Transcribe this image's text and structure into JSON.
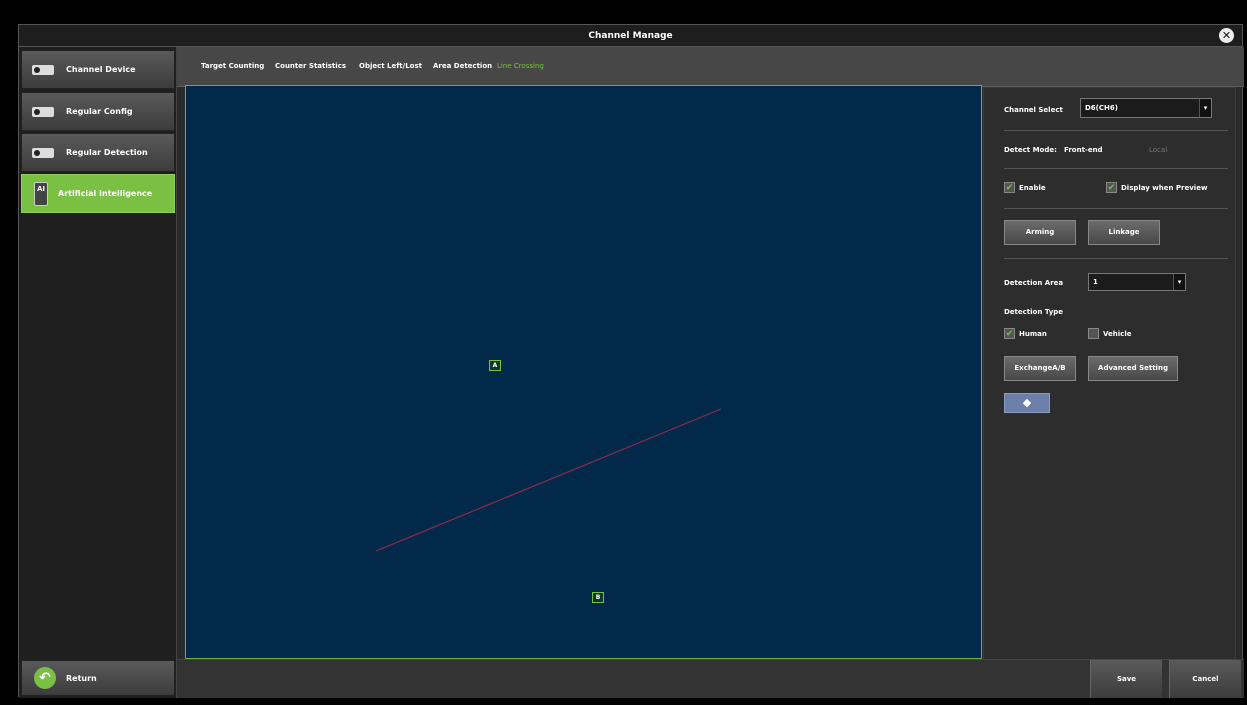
{
  "window": {
    "title": "Channel Manage"
  },
  "sidebar": {
    "items": [
      {
        "label": "Channel Device",
        "icon": "camera-icon"
      },
      {
        "label": "Regular Config",
        "icon": "camera-icon"
      },
      {
        "label": "Regular Detection",
        "icon": "camera-icon"
      },
      {
        "label": "Artificial Intelligence",
        "icon": "ai-icon"
      }
    ],
    "active_index": 3,
    "return_label": "Return"
  },
  "tabs": [
    {
      "label": "Target Counting"
    },
    {
      "label": "Counter Statistics"
    },
    {
      "label": "Object Left/Lost"
    },
    {
      "label": "Area Detection"
    },
    {
      "label": "Line Crossing"
    }
  ],
  "active_tab": "Line Crossing",
  "canvas": {
    "marker_a": "A",
    "marker_b": "B",
    "line_color": "#8b2a4a"
  },
  "panel": {
    "channel_select_label": "Channel Select",
    "channel_select_value": "D6(CH6)",
    "detect_mode_label": "Detect Mode:",
    "detect_mode_option1": "Front-end",
    "detect_mode_option2": "Local",
    "enable_label": "Enable",
    "enable_checked": true,
    "display_preview_label": "Display when Preview",
    "display_preview_checked": true,
    "arming_label": "Arming",
    "linkage_label": "Linkage",
    "detection_area_label": "Detection Area",
    "detection_area_value": "1",
    "detection_type_label": "Detection Type",
    "human_label": "Human",
    "human_checked": true,
    "vehicle_label": "Vehicle",
    "vehicle_checked": false,
    "exchange_label": "ExchangeA/B",
    "advanced_label": "Advanced Setting"
  },
  "footer": {
    "save_label": "Save",
    "cancel_label": "Cancel"
  },
  "colors": {
    "accent": "#7ac043",
    "canvas_bg": "#03294a"
  }
}
